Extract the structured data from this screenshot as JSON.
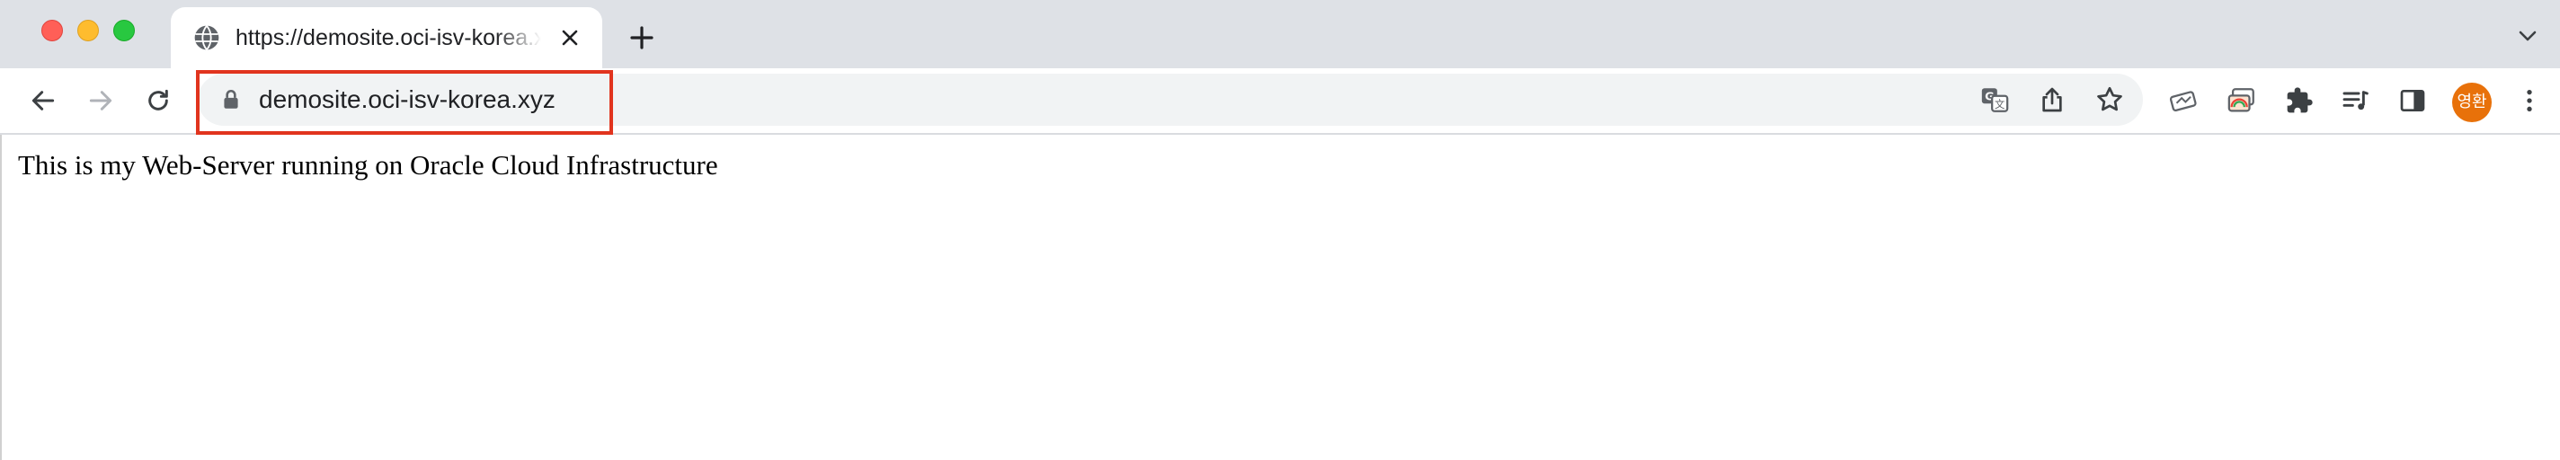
{
  "window": {
    "controls": [
      "close",
      "minimize",
      "zoom"
    ]
  },
  "tab": {
    "title": "https://demosite.oci-isv-korea.xyz/",
    "favicon": "globe-icon"
  },
  "toolbar": {
    "url": "demosite.oci-isv-korea.xyz",
    "nav_icons": [
      "back-arrow-icon",
      "forward-arrow-icon",
      "reload-icon"
    ],
    "omnibox_icons": [
      "translate-icon",
      "share-icon",
      "bookmark-star-icon"
    ],
    "extension_icons": [
      "extension-a-icon",
      "extension-b-icon",
      "puzzle-extensions-icon",
      "reading-list-icon",
      "side-panel-icon"
    ],
    "profile_initials": "영환",
    "profile_color": "#e8710a",
    "highlight_color": "#e1341e"
  },
  "page": {
    "body_text": "This is my Web-Server running on Oracle Cloud Infrastructure"
  }
}
